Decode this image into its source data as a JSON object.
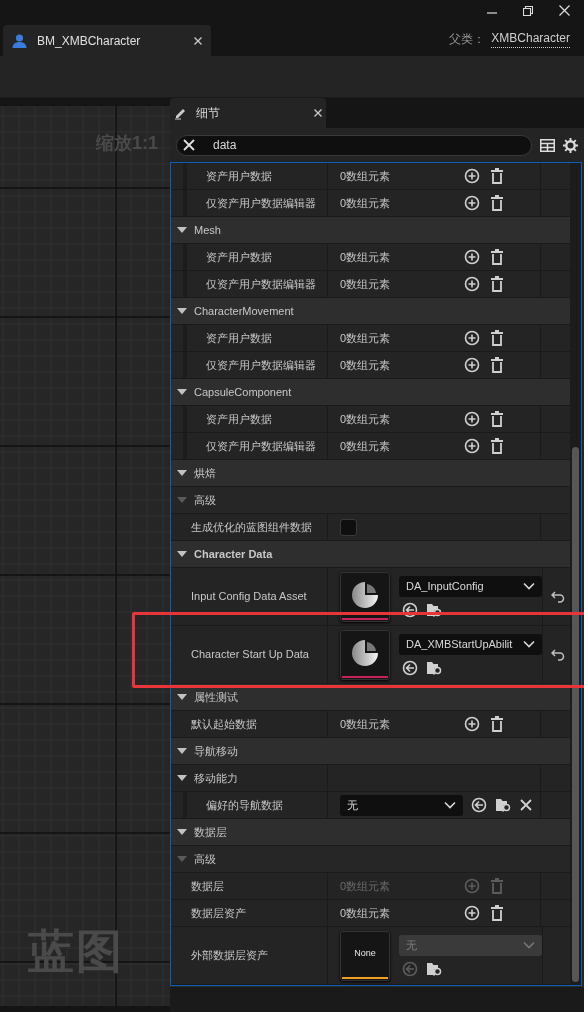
{
  "document_tab": {
    "title": "BM_XMBCharacter"
  },
  "parent_class": {
    "label": "父类：",
    "value": "XMBCharacter"
  },
  "graph": {
    "zoom": "缩放1:1",
    "watermark": "蓝图"
  },
  "details": {
    "tab": "细节",
    "search": {
      "value": "data"
    },
    "items": [
      {
        "kind": "group",
        "children": [
          {
            "kind": "array",
            "label": "资产用户数据",
            "value": "0数组元素",
            "disabled": false
          },
          {
            "kind": "array",
            "label": "仅资产用户数据编辑器",
            "value": "0数组元素",
            "disabled": false
          }
        ]
      },
      {
        "kind": "group",
        "label": "Mesh",
        "expanded": true,
        "children": [
          {
            "kind": "array",
            "label": "资产用户数据",
            "value": "0数组元素",
            "disabled": false
          },
          {
            "kind": "array",
            "label": "仅资产用户数据编辑器",
            "value": "0数组元素",
            "disabled": false
          }
        ]
      },
      {
        "kind": "group",
        "label": "CharacterMovement",
        "expanded": true,
        "children": [
          {
            "kind": "array",
            "label": "资产用户数据",
            "value": "0数组元素",
            "disabled": false
          },
          {
            "kind": "array",
            "label": "仅资产用户数据编辑器",
            "value": "0数组元素",
            "disabled": false
          }
        ]
      },
      {
        "kind": "group",
        "label": "CapsuleComponent",
        "expanded": true,
        "children": [
          {
            "kind": "array",
            "label": "资产用户数据",
            "value": "0数组元素",
            "disabled": false
          },
          {
            "kind": "array",
            "label": "仅资产用户数据编辑器",
            "value": "0数组元素",
            "disabled": false
          }
        ]
      },
      {
        "kind": "category",
        "label": "烘焙",
        "bold": false,
        "expanded": true,
        "children": [
          {
            "kind": "advanced",
            "label": "高级",
            "expanded": true,
            "children": [
              {
                "kind": "checkbox",
                "label": "生成优化的蓝图组件数据",
                "checked": false
              }
            ]
          }
        ]
      },
      {
        "kind": "category",
        "label": "Character Data",
        "bold": true,
        "expanded": true,
        "children": [
          {
            "kind": "asset",
            "label": "Input Config Data Asset",
            "value": "DA_InputConfig",
            "disabled": false,
            "modified": true,
            "color": "#c8235a"
          },
          {
            "kind": "asset",
            "label": "Character Start Up Data",
            "value": "DA_XMBStartUpAbilit",
            "disabled": false,
            "modified": true,
            "color": "#c8235a"
          }
        ]
      },
      {
        "kind": "category",
        "label": "属性测试",
        "bold": false,
        "expanded": true,
        "children": [
          {
            "kind": "array",
            "label": "默认起始数据",
            "value": "0数组元素",
            "disabled": false
          }
        ]
      },
      {
        "kind": "category",
        "label": "导航移动",
        "bold": false,
        "expanded": true,
        "children": [
          {
            "kind": "struct",
            "label": "移动能力",
            "expanded": true,
            "children": [
              {
                "kind": "dropdown",
                "label": "偏好的导航数据",
                "value": "无"
              }
            ]
          }
        ]
      },
      {
        "kind": "category",
        "label": "数据层",
        "bold": false,
        "expanded": true,
        "children": [
          {
            "kind": "advanced",
            "label": "高级",
            "expanded": true,
            "children": [
              {
                "kind": "array",
                "label": "数据层",
                "value": "0数组元素",
                "disabled": true
              },
              {
                "kind": "array",
                "label": "数据层资产",
                "value": "0数组元素",
                "disabled": false
              },
              {
                "kind": "asset",
                "label": "外部数据层资产",
                "value": "无",
                "thumbnail_text": "None",
                "disabled": true,
                "modified": false,
                "color": "#f0a020"
              }
            ]
          }
        ]
      }
    ]
  }
}
